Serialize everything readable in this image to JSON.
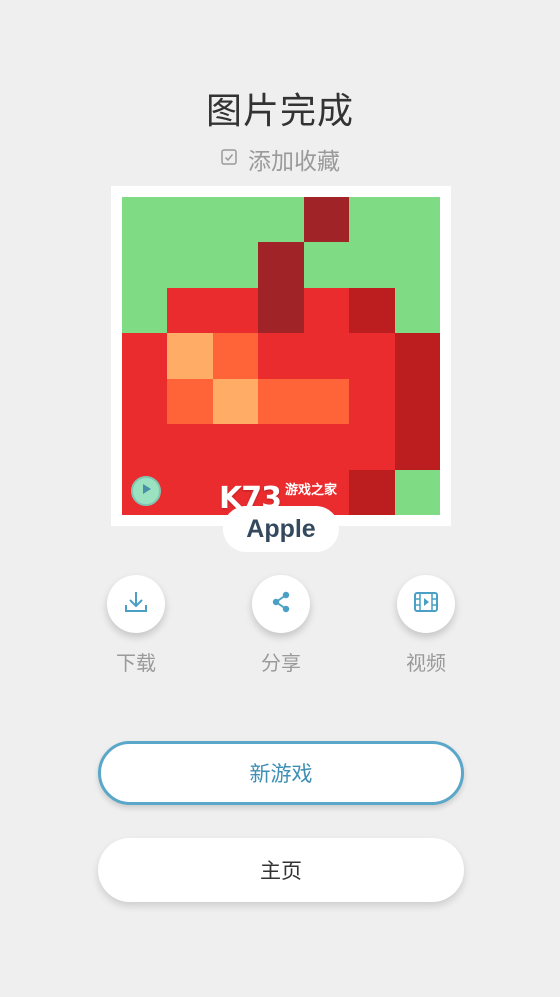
{
  "header": {
    "title": "图片完成",
    "favorite_label": "添加收藏"
  },
  "artwork": {
    "name": "Apple",
    "watermark_main": "K73",
    "watermark_sub": "游戏之家",
    "palette": {
      "g": "#7fdb84",
      "r": "#ea2c2e",
      "d": "#a02427",
      "b": "#bc1d1f",
      "l": "#ffac67",
      "o": "#ff6438"
    },
    "pixels": [
      [
        "g",
        "g",
        "g",
        "g",
        "d",
        "g",
        "g"
      ],
      [
        "g",
        "g",
        "g",
        "d",
        "g",
        "g",
        "g"
      ],
      [
        "g",
        "r",
        "r",
        "d",
        "r",
        "b",
        "g"
      ],
      [
        "r",
        "l",
        "o",
        "r",
        "r",
        "r",
        "b"
      ],
      [
        "r",
        "o",
        "l",
        "o",
        "o",
        "r",
        "b"
      ],
      [
        "r",
        "r",
        "r",
        "r",
        "r",
        "r",
        "b"
      ],
      [
        "r",
        "r",
        "r",
        "r",
        "r",
        "b",
        "g"
      ]
    ]
  },
  "actions": [
    {
      "label": "下载",
      "icon": "download-icon"
    },
    {
      "label": "分享",
      "icon": "share-icon"
    },
    {
      "label": "视频",
      "icon": "video-icon"
    }
  ],
  "buttons": {
    "new_game": "新游戏",
    "home": "主页"
  },
  "colors": {
    "accent": "#4a9fc4",
    "background": "#efefef"
  }
}
